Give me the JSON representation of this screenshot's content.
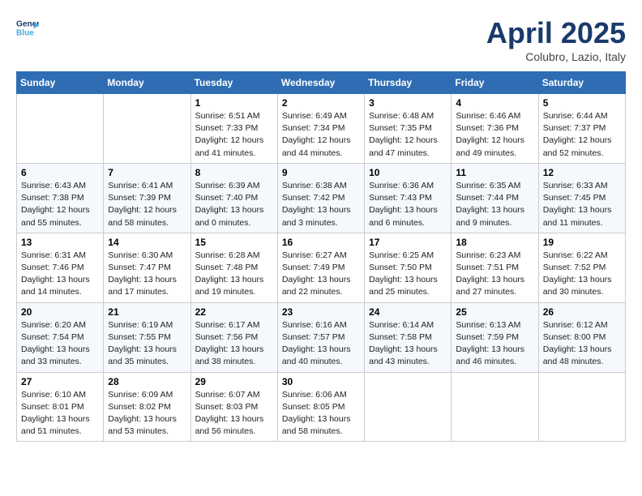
{
  "header": {
    "logo_line1": "General",
    "logo_line2": "Blue",
    "month_title": "April 2025",
    "location": "Colubro, Lazio, Italy"
  },
  "weekdays": [
    "Sunday",
    "Monday",
    "Tuesday",
    "Wednesday",
    "Thursday",
    "Friday",
    "Saturday"
  ],
  "weeks": [
    [
      {
        "day": "",
        "sunrise": "",
        "sunset": "",
        "daylight": ""
      },
      {
        "day": "",
        "sunrise": "",
        "sunset": "",
        "daylight": ""
      },
      {
        "day": "1",
        "sunrise": "Sunrise: 6:51 AM",
        "sunset": "Sunset: 7:33 PM",
        "daylight": "Daylight: 12 hours and 41 minutes."
      },
      {
        "day": "2",
        "sunrise": "Sunrise: 6:49 AM",
        "sunset": "Sunset: 7:34 PM",
        "daylight": "Daylight: 12 hours and 44 minutes."
      },
      {
        "day": "3",
        "sunrise": "Sunrise: 6:48 AM",
        "sunset": "Sunset: 7:35 PM",
        "daylight": "Daylight: 12 hours and 47 minutes."
      },
      {
        "day": "4",
        "sunrise": "Sunrise: 6:46 AM",
        "sunset": "Sunset: 7:36 PM",
        "daylight": "Daylight: 12 hours and 49 minutes."
      },
      {
        "day": "5",
        "sunrise": "Sunrise: 6:44 AM",
        "sunset": "Sunset: 7:37 PM",
        "daylight": "Daylight: 12 hours and 52 minutes."
      }
    ],
    [
      {
        "day": "6",
        "sunrise": "Sunrise: 6:43 AM",
        "sunset": "Sunset: 7:38 PM",
        "daylight": "Daylight: 12 hours and 55 minutes."
      },
      {
        "day": "7",
        "sunrise": "Sunrise: 6:41 AM",
        "sunset": "Sunset: 7:39 PM",
        "daylight": "Daylight: 12 hours and 58 minutes."
      },
      {
        "day": "8",
        "sunrise": "Sunrise: 6:39 AM",
        "sunset": "Sunset: 7:40 PM",
        "daylight": "Daylight: 13 hours and 0 minutes."
      },
      {
        "day": "9",
        "sunrise": "Sunrise: 6:38 AM",
        "sunset": "Sunset: 7:42 PM",
        "daylight": "Daylight: 13 hours and 3 minutes."
      },
      {
        "day": "10",
        "sunrise": "Sunrise: 6:36 AM",
        "sunset": "Sunset: 7:43 PM",
        "daylight": "Daylight: 13 hours and 6 minutes."
      },
      {
        "day": "11",
        "sunrise": "Sunrise: 6:35 AM",
        "sunset": "Sunset: 7:44 PM",
        "daylight": "Daylight: 13 hours and 9 minutes."
      },
      {
        "day": "12",
        "sunrise": "Sunrise: 6:33 AM",
        "sunset": "Sunset: 7:45 PM",
        "daylight": "Daylight: 13 hours and 11 minutes."
      }
    ],
    [
      {
        "day": "13",
        "sunrise": "Sunrise: 6:31 AM",
        "sunset": "Sunset: 7:46 PM",
        "daylight": "Daylight: 13 hours and 14 minutes."
      },
      {
        "day": "14",
        "sunrise": "Sunrise: 6:30 AM",
        "sunset": "Sunset: 7:47 PM",
        "daylight": "Daylight: 13 hours and 17 minutes."
      },
      {
        "day": "15",
        "sunrise": "Sunrise: 6:28 AM",
        "sunset": "Sunset: 7:48 PM",
        "daylight": "Daylight: 13 hours and 19 minutes."
      },
      {
        "day": "16",
        "sunrise": "Sunrise: 6:27 AM",
        "sunset": "Sunset: 7:49 PM",
        "daylight": "Daylight: 13 hours and 22 minutes."
      },
      {
        "day": "17",
        "sunrise": "Sunrise: 6:25 AM",
        "sunset": "Sunset: 7:50 PM",
        "daylight": "Daylight: 13 hours and 25 minutes."
      },
      {
        "day": "18",
        "sunrise": "Sunrise: 6:23 AM",
        "sunset": "Sunset: 7:51 PM",
        "daylight": "Daylight: 13 hours and 27 minutes."
      },
      {
        "day": "19",
        "sunrise": "Sunrise: 6:22 AM",
        "sunset": "Sunset: 7:52 PM",
        "daylight": "Daylight: 13 hours and 30 minutes."
      }
    ],
    [
      {
        "day": "20",
        "sunrise": "Sunrise: 6:20 AM",
        "sunset": "Sunset: 7:54 PM",
        "daylight": "Daylight: 13 hours and 33 minutes."
      },
      {
        "day": "21",
        "sunrise": "Sunrise: 6:19 AM",
        "sunset": "Sunset: 7:55 PM",
        "daylight": "Daylight: 13 hours and 35 minutes."
      },
      {
        "day": "22",
        "sunrise": "Sunrise: 6:17 AM",
        "sunset": "Sunset: 7:56 PM",
        "daylight": "Daylight: 13 hours and 38 minutes."
      },
      {
        "day": "23",
        "sunrise": "Sunrise: 6:16 AM",
        "sunset": "Sunset: 7:57 PM",
        "daylight": "Daylight: 13 hours and 40 minutes."
      },
      {
        "day": "24",
        "sunrise": "Sunrise: 6:14 AM",
        "sunset": "Sunset: 7:58 PM",
        "daylight": "Daylight: 13 hours and 43 minutes."
      },
      {
        "day": "25",
        "sunrise": "Sunrise: 6:13 AM",
        "sunset": "Sunset: 7:59 PM",
        "daylight": "Daylight: 13 hours and 46 minutes."
      },
      {
        "day": "26",
        "sunrise": "Sunrise: 6:12 AM",
        "sunset": "Sunset: 8:00 PM",
        "daylight": "Daylight: 13 hours and 48 minutes."
      }
    ],
    [
      {
        "day": "27",
        "sunrise": "Sunrise: 6:10 AM",
        "sunset": "Sunset: 8:01 PM",
        "daylight": "Daylight: 13 hours and 51 minutes."
      },
      {
        "day": "28",
        "sunrise": "Sunrise: 6:09 AM",
        "sunset": "Sunset: 8:02 PM",
        "daylight": "Daylight: 13 hours and 53 minutes."
      },
      {
        "day": "29",
        "sunrise": "Sunrise: 6:07 AM",
        "sunset": "Sunset: 8:03 PM",
        "daylight": "Daylight: 13 hours and 56 minutes."
      },
      {
        "day": "30",
        "sunrise": "Sunrise: 6:06 AM",
        "sunset": "Sunset: 8:05 PM",
        "daylight": "Daylight: 13 hours and 58 minutes."
      },
      {
        "day": "",
        "sunrise": "",
        "sunset": "",
        "daylight": ""
      },
      {
        "day": "",
        "sunrise": "",
        "sunset": "",
        "daylight": ""
      },
      {
        "day": "",
        "sunrise": "",
        "sunset": "",
        "daylight": ""
      }
    ]
  ]
}
